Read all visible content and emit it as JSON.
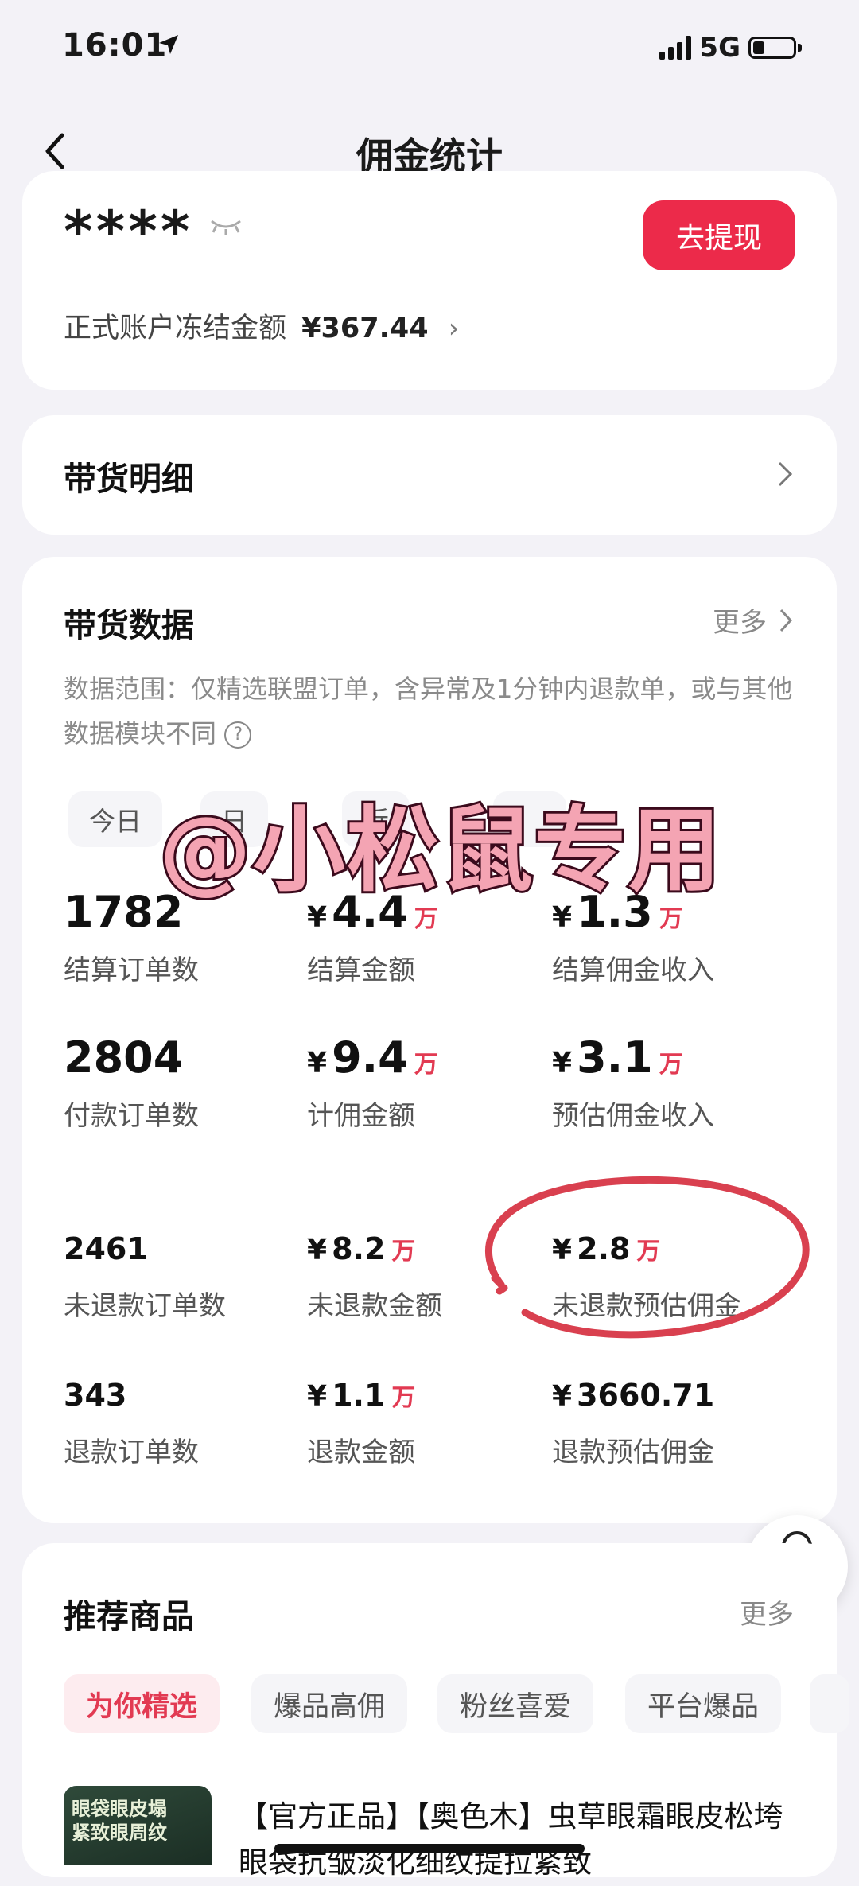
{
  "status_bar": {
    "time": "16:01",
    "network": "5G"
  },
  "nav": {
    "title": "佣金统计"
  },
  "account": {
    "masked_balance": "****",
    "withdraw_label": "去提现",
    "frozen_label": "正式账户冻结金额",
    "frozen_amount": "¥367.44"
  },
  "goods_detail": {
    "label": "带货明细"
  },
  "sales_data": {
    "title": "带货数据",
    "more": "更多",
    "description": "数据范围：仅精选联盟订单，含异常及1分钟内退款单，或与其他数据模块不同",
    "ranges": [
      "今日",
      "日",
      "近",
      ""
    ],
    "watermark": "@小松鼠专用",
    "stats": [
      {
        "value": "1782",
        "label": "结算订单数"
      },
      {
        "yen": "¥",
        "value": "4.4",
        "unit": "万",
        "label": "结算金额"
      },
      {
        "yen": "¥",
        "value": "1.3",
        "unit": "万",
        "label": "结算佣金收入"
      },
      {
        "value": "2804",
        "label": "付款订单数"
      },
      {
        "yen": "¥",
        "value": "9.4",
        "unit": "万",
        "label": "计佣金额"
      },
      {
        "yen": "¥",
        "value": "3.1",
        "unit": "万",
        "label": "预估佣金收入"
      },
      {
        "value": "2461",
        "label": "未退款订单数"
      },
      {
        "yen": "¥",
        "value": "8.2",
        "unit": "万",
        "label": "未退款金额"
      },
      {
        "yen": "¥",
        "value": "2.8",
        "unit": "万",
        "label": "未退款预估佣金"
      },
      {
        "value": "343",
        "label": "退款订单数"
      },
      {
        "yen": "¥",
        "value": "1.1",
        "unit": "万",
        "label": "退款金额"
      },
      {
        "yen": "¥",
        "value": "3660.71",
        "unit": "",
        "label": "退款预估佣金"
      }
    ],
    "highlight_color": "#d9404f"
  },
  "customer_service": {
    "label": "客服"
  },
  "recommended": {
    "title": "推荐商品",
    "more": "更多",
    "tabs": [
      "为你精选",
      "爆品高佣",
      "粉丝喜爱",
      "平台爆品"
    ],
    "product": {
      "thumb_text": [
        "眼袋眼皮塌",
        "紧致眼周纹"
      ],
      "title": "【官方正品】【奥色木】虫草眼霜眼皮松垮眼袋抗皱淡化细纹提拉紧致"
    }
  },
  "colors": {
    "accent": "#ec2a4a",
    "unit_red": "#e23a52",
    "background": "#f3f2f7"
  }
}
